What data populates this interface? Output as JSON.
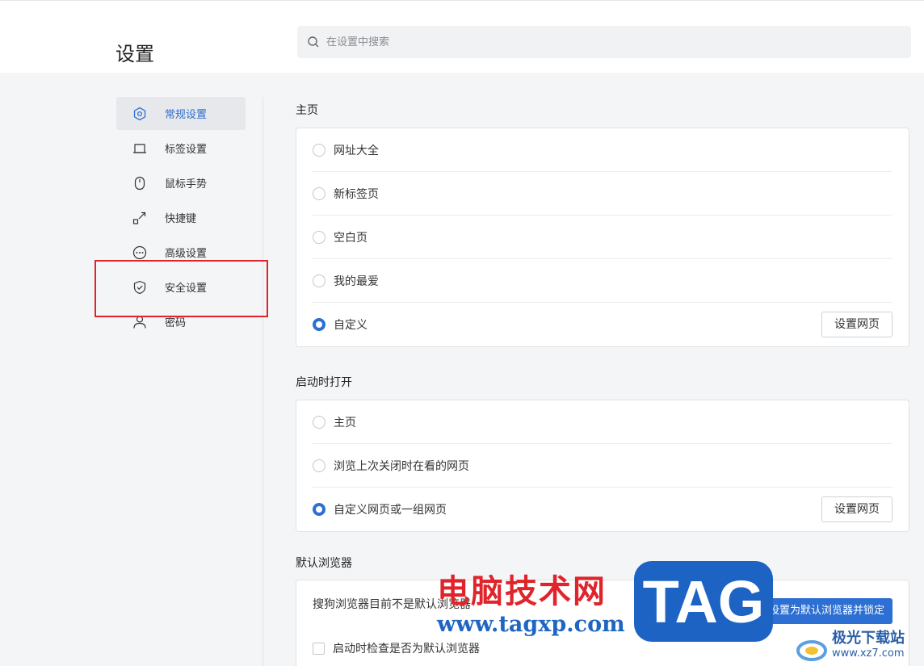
{
  "header": {
    "title": "设置",
    "search_placeholder": "在设置中搜索"
  },
  "sidebar": {
    "items": [
      {
        "label": "常规设置",
        "icon": "hexagon-settings-icon",
        "active": true
      },
      {
        "label": "标签设置",
        "icon": "tab-icon"
      },
      {
        "label": "鼠标手势",
        "icon": "mouse-icon"
      },
      {
        "label": "快捷键",
        "icon": "shortcut-arrow-icon"
      },
      {
        "label": "高级设置",
        "icon": "more-dots-icon"
      },
      {
        "label": "安全设置",
        "icon": "shield-check-icon"
      },
      {
        "label": "密码",
        "icon": "user-icon"
      }
    ]
  },
  "homepage": {
    "title": "主页",
    "options": [
      "网址大全",
      "新标签页",
      "空白页",
      "我的最爱",
      "自定义"
    ],
    "selected": "自定义",
    "button": "设置网页"
  },
  "startup": {
    "title": "启动时打开",
    "options": [
      "主页",
      "浏览上次关闭时在看的网页",
      "自定义网页或一组网页"
    ],
    "selected": "自定义网页或一组网页",
    "button": "设置网页"
  },
  "default_browser": {
    "title": "默认浏览器",
    "status": "搜狗浏览器目前不是默认浏览器",
    "button": "设置为默认浏览器并锁定",
    "checkbox": "启动时检查是否为默认浏览器"
  },
  "watermark": {
    "cn_text": "电脑技术网",
    "url": "www.tagxp.com",
    "tag": "TAG",
    "site": "极光下载站",
    "site_url": "www.xz7.com"
  },
  "colors": {
    "accent": "#2d6fd2",
    "highlight_box": "#e0242b"
  }
}
